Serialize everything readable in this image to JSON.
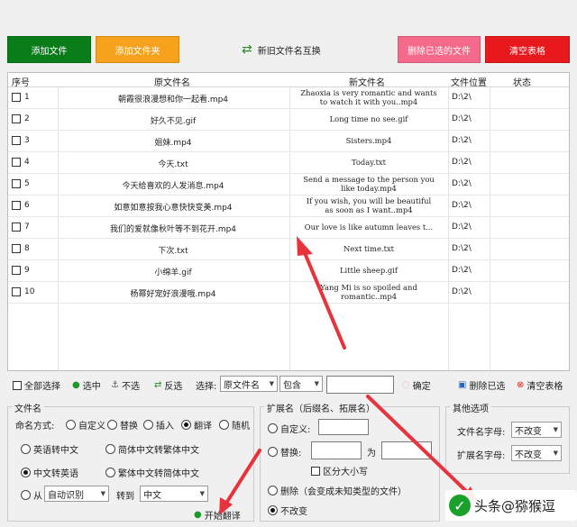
{
  "toolbar": {
    "add_file": "添加文件",
    "add_folder": "添加文件夹",
    "swap": "新旧文件名互换",
    "delete_selected": "删除已选的文件",
    "clear_table": "清空表格"
  },
  "table": {
    "headers": {
      "index": "序号",
      "original": "原文件名",
      "new": "新文件名",
      "location": "文件位置",
      "status": "状态"
    },
    "rows": [
      {
        "index": "1",
        "original": "朝霞很浪漫想和你一起看.mp4",
        "new_line1": "Zhaoxia is very romantic and wants",
        "new_line2": "to watch it with you..mp4",
        "location": "D:\\2\\"
      },
      {
        "index": "2",
        "original": "好久不见.gif",
        "new_line1": "Long time no see.gif",
        "new_line2": "",
        "location": "D:\\2\\"
      },
      {
        "index": "3",
        "original": "姐妹.mp4",
        "new_line1": "Sisters.mp4",
        "new_line2": "",
        "location": "D:\\2\\"
      },
      {
        "index": "4",
        "original": "今天.txt",
        "new_line1": "Today.txt",
        "new_line2": "",
        "location": "D:\\2\\"
      },
      {
        "index": "5",
        "original": "今天给喜欢的人发消息.mp4",
        "new_line1": "Send a message to the person you",
        "new_line2": "like today.mp4",
        "location": "D:\\2\\"
      },
      {
        "index": "6",
        "original": "如意如意按我心意快快变美.mp4",
        "new_line1": "If you wish, you will be beautiful",
        "new_line2": "as soon as I want..mp4",
        "location": "D:\\2\\"
      },
      {
        "index": "7",
        "original": "我们的爱就像秋叶等不到花开.mp4",
        "new_line1": "Our love is like autumn leaves t...",
        "new_line2": "",
        "location": "D:\\2\\"
      },
      {
        "index": "8",
        "original": "下次.txt",
        "new_line1": "Next time.txt",
        "new_line2": "",
        "location": "D:\\2\\"
      },
      {
        "index": "9",
        "original": "小绵羊.gif",
        "new_line1": "Little sheep.gif",
        "new_line2": "",
        "location": "D:\\2\\"
      },
      {
        "index": "10",
        "original": "杨幂好宠好浪漫哦.mp4",
        "new_line1": "Yang Mi is so spoiled and",
        "new_line2": "romantic..mp4",
        "location": "D:\\2\\"
      }
    ]
  },
  "filter": {
    "select_all": "全部选择",
    "select": "选中",
    "deselect": "不选",
    "invert": "反选",
    "choose_label": "选择:",
    "field_value": "原文件名",
    "match_value": "包含",
    "confirm": "确定",
    "delete_selected": "删除已选",
    "clear_table": "清空表格"
  },
  "filename_panel": {
    "title": "文件名",
    "naming_label": "命名方式:",
    "opt_custom": "自定义",
    "opt_replace": "替换",
    "opt_insert": "插入",
    "opt_translate": "翻译",
    "opt_random": "随机",
    "en_to_zh": "英语转中文",
    "simp_to_trad": "简体中文转繁体中文",
    "zh_to_en": "中文转英语",
    "trad_to_simp": "繁体中文转简体中文",
    "from_label": "从",
    "from_value": "自动识别",
    "to_label": "转到",
    "to_value": "中文",
    "start_translate": "开始翻译"
  },
  "ext_panel": {
    "title": "扩展名（后缀名、拓展名）",
    "custom": "自定义:",
    "replace": "替换:",
    "to": "为",
    "case_sensitive": "区分大小写",
    "delete": "删除（会变成未知类型的文件）",
    "no_change": "不改变"
  },
  "other_panel": {
    "title": "其他选项",
    "filename_case": "文件名字母:",
    "filename_case_value": "不改变",
    "ext_case": "扩展名字母:",
    "ext_case_value": "不改变"
  },
  "watermark": "头条@猕猴逗",
  "colors": {
    "add_file": "#0a7d1a",
    "add_folder": "#f6a21d",
    "delete_selected": "#f56a8a",
    "clear_table": "#e8191c",
    "arrow": "#e8323c"
  }
}
